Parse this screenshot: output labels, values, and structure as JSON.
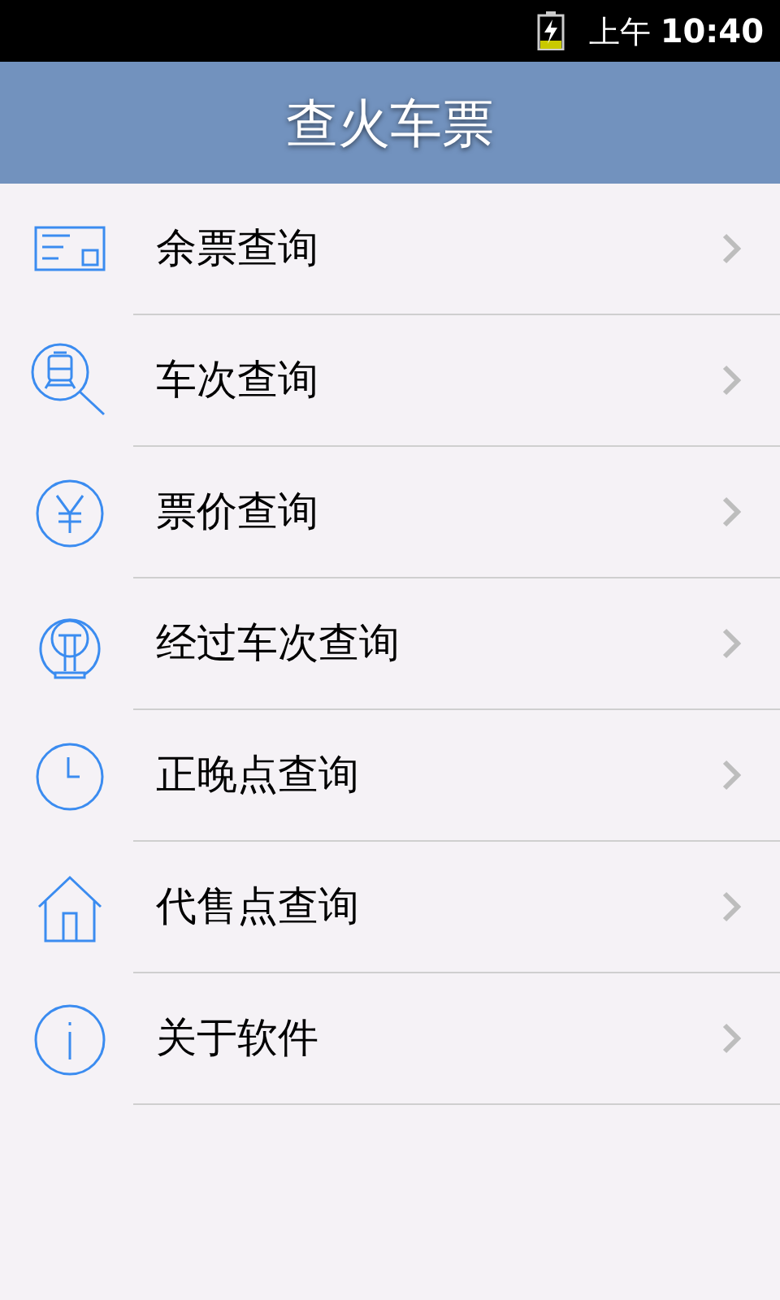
{
  "status_bar": {
    "period": "上午",
    "time": "10:40"
  },
  "header": {
    "title": "查火车票"
  },
  "menu": [
    {
      "kind": "ticket",
      "label": "余票查询"
    },
    {
      "kind": "train",
      "label": "车次查询"
    },
    {
      "kind": "yuan",
      "label": "票价查询"
    },
    {
      "kind": "rail",
      "label": "经过车次查询"
    },
    {
      "kind": "clock",
      "label": "正晚点查询"
    },
    {
      "kind": "house",
      "label": "代售点查询"
    },
    {
      "kind": "info",
      "label": "关于软件"
    }
  ]
}
